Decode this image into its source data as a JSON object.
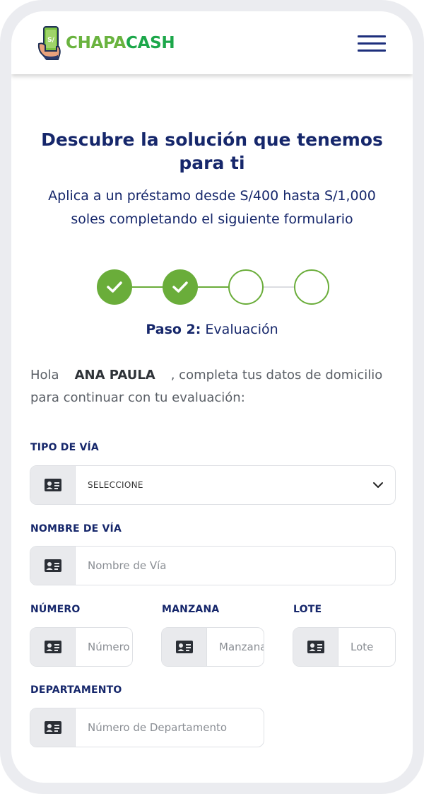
{
  "brand": {
    "name_part1": "CHAPA",
    "name_part2": "CASH",
    "logo_symbol": "S/"
  },
  "header": {
    "menu_icon": "hamburger-icon"
  },
  "hero": {
    "title": "Descubre la solución que tenemos para ti",
    "subtitle": "Aplica a un préstamo desde S/400 hasta S/1,000 soles completando el siguiente formulario"
  },
  "stepper": {
    "steps": [
      {
        "status": "completed",
        "icon": "check-icon"
      },
      {
        "status": "completed",
        "icon": "check-icon"
      },
      {
        "status": "pending"
      },
      {
        "status": "pending"
      }
    ],
    "current_label_bold": "Paso 2:",
    "current_label": "Evaluación"
  },
  "greeting": {
    "prefix": "Hola",
    "name": "ANA PAULA",
    "suffix": ", completa tus datos de domicilio para continuar con tu evaluación:"
  },
  "form": {
    "tipo_via": {
      "label": "TIPO DE VÍA",
      "selected": "SELECCIONE",
      "icon": "id-card-icon"
    },
    "nombre_via": {
      "label": "NOMBRE DE VÍA",
      "placeholder": "Nombre de Vía",
      "icon": "id-card-icon"
    },
    "numero": {
      "label": "NÚMERO",
      "placeholder": "Número",
      "icon": "id-card-icon"
    },
    "manzana": {
      "label": "MANZANA",
      "placeholder": "Manzana",
      "icon": "id-card-icon"
    },
    "lote": {
      "label": "LOTE",
      "placeholder": "Lote",
      "icon": "id-card-icon"
    },
    "departamento": {
      "label": "DEPARTAMENTO",
      "placeholder": "Número de Departamento",
      "icon": "id-card-icon"
    }
  },
  "colors": {
    "primary": "#16276b",
    "accent_green": "#6aad3a",
    "brand_green": "#1ca74a"
  }
}
